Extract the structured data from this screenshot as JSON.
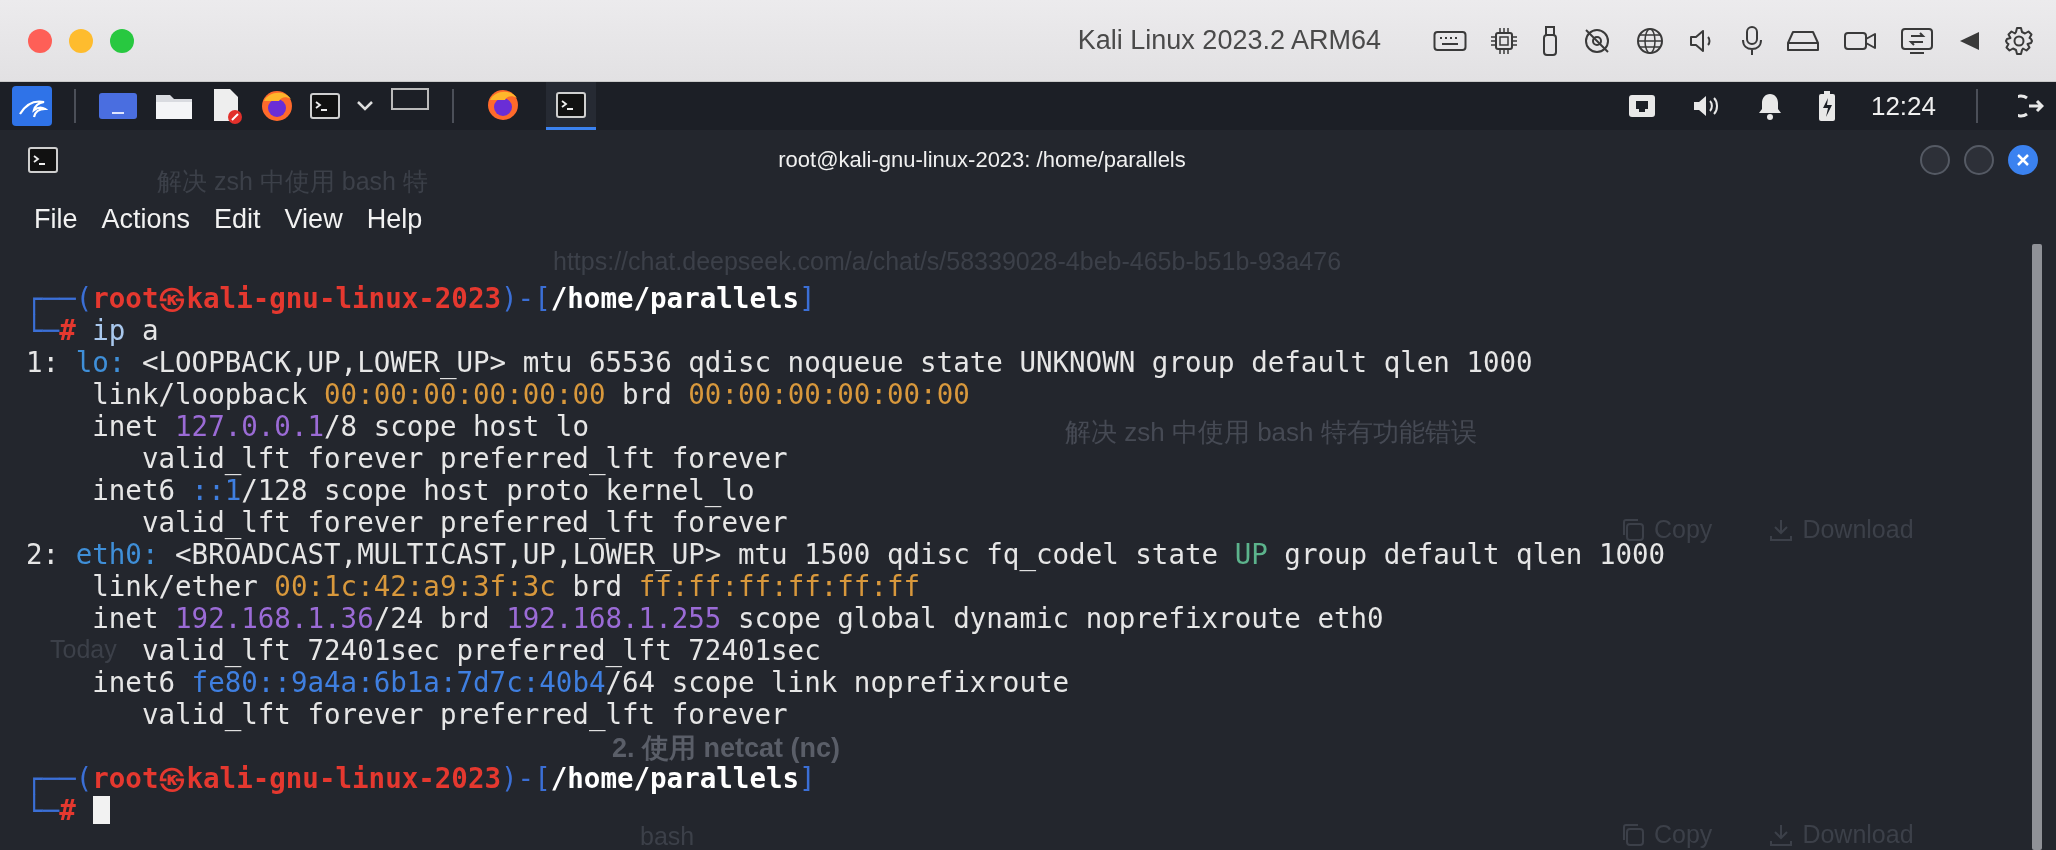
{
  "host_window": {
    "title": "Kali Linux 2023.2 ARM64"
  },
  "panel": {
    "tasks": [
      {
        "kind": "browser",
        "selected": false
      },
      {
        "kind": "terminal",
        "selected": true
      }
    ],
    "clock": "12:24"
  },
  "background_browser": {
    "tab_title": "解决 zsh 中使用 bash 特",
    "url": "https://chat.deepseek.com/a/chat/s/58339028-4beb-465b-b51b-93a476",
    "sidebar_label": "Today",
    "heading": "解决 zsh 中使用 bash 特有功能错误",
    "blocks": [
      {
        "actions": [
          "Copy",
          "Download"
        ]
      },
      {
        "title": "2. 使用 netcat (nc)",
        "language": "bash",
        "actions": [
          "Copy",
          "Download"
        ]
      }
    ]
  },
  "terminal": {
    "title": "root@kali-gnu-linux-2023: /home/parallels",
    "menu": [
      "File",
      "Actions",
      "Edit",
      "View",
      "Help"
    ],
    "blocks": [
      {
        "lines": [
          {
            "segments": [
              {
                "text": "┌──(",
                "color": "#3b6fd6"
              },
              {
                "text": "root㉿kali-gnu-linux-2023",
                "color": "#e5382f",
                "bold": true
              },
              {
                "text": ")-[",
                "color": "#3b6fd6"
              },
              {
                "text": "/home/parallels",
                "color": "#ffffff",
                "bold": true
              },
              {
                "text": "]",
                "color": "#3b6fd6"
              }
            ]
          },
          {
            "segments": [
              {
                "text": "└─",
                "color": "#3b6fd6"
              },
              {
                "text": "#",
                "color": "#e5382f",
                "bold": true
              },
              {
                "text": " ip",
                "color": "#a9c8ee"
              },
              {
                "text": " a"
              }
            ]
          },
          {
            "segments": [
              {
                "text": "1: "
              },
              {
                "text": "lo:",
                "color": "#3f8fd8"
              },
              {
                "text": " <LOOPBACK,UP,LOWER_UP> mtu 65536 qdisc noqueue state UNKNOWN group default qlen 1000"
              }
            ]
          },
          {
            "segments": [
              {
                "text": "    link/loopback "
              },
              {
                "text": "00:00:00:00:00:00",
                "color": "#d8983c"
              },
              {
                "text": " brd "
              },
              {
                "text": "00:00:00:00:00:00",
                "color": "#d8983c"
              }
            ]
          },
          {
            "segments": [
              {
                "text": "    inet "
              },
              {
                "text": "127.0.0.1",
                "color": "#9b6bd6"
              },
              {
                "text": "/8 scope host lo"
              }
            ]
          },
          {
            "segments": [
              {
                "text": "       valid_lft forever preferred_lft forever"
              }
            ]
          },
          {
            "segments": [
              {
                "text": "    inet6 "
              },
              {
                "text": "::1",
                "color": "#3f7fe0"
              },
              {
                "text": "/128 scope host proto kernel_lo"
              }
            ]
          },
          {
            "segments": [
              {
                "text": "       valid_lft forever preferred_lft forever"
              }
            ]
          },
          {
            "segments": [
              {
                "text": "2: "
              },
              {
                "text": "eth0:",
                "color": "#3f8fd8"
              },
              {
                "text": " <BROADCAST,MULTICAST,UP,LOWER_UP> mtu 1500 qdisc fq_codel state "
              },
              {
                "text": "UP",
                "color": "#5cb38c"
              },
              {
                "text": " group default qlen 1000"
              }
            ]
          },
          {
            "segments": [
              {
                "text": "    link/ether "
              },
              {
                "text": "00:1c:42:a9:3f:3c",
                "color": "#d8983c"
              },
              {
                "text": " brd "
              },
              {
                "text": "ff:ff:ff:ff:ff:ff",
                "color": "#d8983c"
              }
            ]
          },
          {
            "segments": [
              {
                "text": "    inet "
              },
              {
                "text": "192.168.1.36",
                "color": "#9b6bd6"
              },
              {
                "text": "/24 brd "
              },
              {
                "text": "192.168.1.255",
                "color": "#9b6bd6"
              },
              {
                "text": " scope global dynamic noprefixroute eth0"
              }
            ]
          },
          {
            "segments": [
              {
                "text": "       valid_lft 72401sec preferred_lft 72401sec"
              }
            ]
          },
          {
            "segments": [
              {
                "text": "    inet6 "
              },
              {
                "text": "fe80::9a4a:6b1a:7d7c:40b4",
                "color": "#3f7fe0"
              },
              {
                "text": "/64 scope link noprefixroute"
              }
            ]
          },
          {
            "segments": [
              {
                "text": "       valid_lft forever preferred_lft forever"
              }
            ]
          }
        ]
      },
      {
        "lines": [
          {
            "segments": [
              {
                "text": "┌──(",
                "color": "#3b6fd6"
              },
              {
                "text": "root㉿kali-gnu-linux-2023",
                "color": "#e5382f",
                "bold": true
              },
              {
                "text": ")-[",
                "color": "#3b6fd6"
              },
              {
                "text": "/home/parallels",
                "color": "#ffffff",
                "bold": true
              },
              {
                "text": "]",
                "color": "#3b6fd6"
              }
            ]
          },
          {
            "segments": [
              {
                "text": "└─",
                "color": "#3b6fd6"
              },
              {
                "text": "#",
                "color": "#e5382f",
                "bold": true
              }
            ],
            "cursor": true
          }
        ]
      }
    ]
  }
}
